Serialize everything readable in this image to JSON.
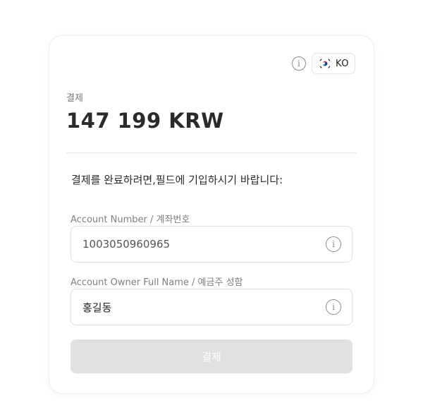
{
  "header": {
    "language_code": "KO"
  },
  "payment": {
    "label": "결제",
    "amount": "147 199 KRW"
  },
  "form": {
    "instruction": "결제를 완료하려면,필드에 기입하시기 바랍니다:",
    "account_number": {
      "label": "Account Number / 계좌번호",
      "value": "1003050960965"
    },
    "account_owner": {
      "label": "Account Owner Full Name / 예금주 성함",
      "value": "홍길동"
    },
    "submit_label": "결제"
  },
  "icons": {
    "header_info": "info-icon",
    "flag": "south-korea-flag-icon",
    "field_info": "info-icon"
  },
  "colors": {
    "submit_disabled_bg": "#e0e0e0",
    "amount_text": "#2a2a2a",
    "label_text": "#808080"
  }
}
